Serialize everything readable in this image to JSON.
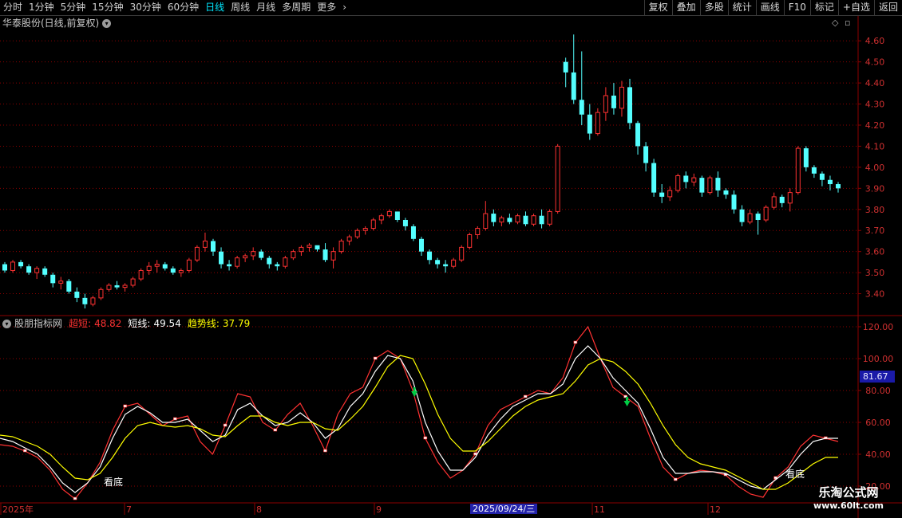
{
  "toolbar": {
    "periods": [
      "分时",
      "1分钟",
      "5分钟",
      "15分钟",
      "30分钟",
      "60分钟",
      "日线",
      "周线",
      "月线",
      "多周期",
      "更多"
    ],
    "active_period": "日线",
    "right_buttons": [
      "复权",
      "叠加",
      "多股",
      "统计",
      "画线",
      "F10",
      "标记",
      "+自选",
      "返回"
    ]
  },
  "main_chart": {
    "title": "华泰股份(日线,前复权)",
    "y_ticks": [
      "4.60",
      "4.50",
      "4.40",
      "4.30",
      "4.20",
      "4.10",
      "4.00",
      "3.90",
      "3.80",
      "3.70",
      "3.60",
      "3.50",
      "3.40"
    ]
  },
  "indicator": {
    "name": "股朋指标网",
    "label1": "超短:",
    "value1": "48.82",
    "label2": "短线:",
    "value2": "49.54",
    "label3": "趋势线:",
    "value3": "37.79",
    "y_ticks": [
      "120.00",
      "100.00",
      "80.00",
      "60.00",
      "40.00",
      "20.00"
    ],
    "current_value": "81.67",
    "signal_text": "看底"
  },
  "x_axis": {
    "labels": [
      "2025年",
      "7",
      "8",
      "9",
      "11",
      "12"
    ],
    "cursor_date": "2025/09/24/三"
  },
  "watermark": {
    "line1": "乐淘公式网",
    "line2": "www.60lt.com"
  },
  "colors": {
    "up": "#ff3232",
    "down": "#54ffff",
    "grid": "#8c0000",
    "short": "#ff3232",
    "mid": "#ffffff",
    "trend": "#ffff00"
  },
  "chart_data": {
    "type": "candlestick",
    "title": "华泰股份(日线,前复权)",
    "price_range": [
      3.3,
      4.65
    ],
    "indicator_range": [
      10,
      125
    ],
    "candles": [
      [
        3.54,
        3.55,
        3.5,
        3.51
      ],
      [
        3.51,
        3.56,
        3.5,
        3.55
      ],
      [
        3.55,
        3.56,
        3.52,
        3.53
      ],
      [
        3.53,
        3.54,
        3.49,
        3.5
      ],
      [
        3.5,
        3.53,
        3.47,
        3.52
      ],
      [
        3.52,
        3.53,
        3.48,
        3.49
      ],
      [
        3.49,
        3.5,
        3.43,
        3.45
      ],
      [
        3.45,
        3.48,
        3.42,
        3.46
      ],
      [
        3.46,
        3.47,
        3.4,
        3.41
      ],
      [
        3.41,
        3.43,
        3.36,
        3.38
      ],
      [
        3.38,
        3.4,
        3.33,
        3.35
      ],
      [
        3.35,
        3.39,
        3.34,
        3.38
      ],
      [
        3.38,
        3.43,
        3.37,
        3.42
      ],
      [
        3.42,
        3.45,
        3.41,
        3.44
      ],
      [
        3.44,
        3.46,
        3.42,
        3.43
      ],
      [
        3.43,
        3.45,
        3.41,
        3.44
      ],
      [
        3.44,
        3.48,
        3.43,
        3.47
      ],
      [
        3.47,
        3.52,
        3.46,
        3.51
      ],
      [
        3.51,
        3.55,
        3.49,
        3.53
      ],
      [
        3.53,
        3.56,
        3.5,
        3.54
      ],
      [
        3.54,
        3.55,
        3.51,
        3.52
      ],
      [
        3.52,
        3.53,
        3.49,
        3.5
      ],
      [
        3.5,
        3.52,
        3.48,
        3.51
      ],
      [
        3.51,
        3.57,
        3.5,
        3.56
      ],
      [
        3.56,
        3.63,
        3.55,
        3.62
      ],
      [
        3.62,
        3.69,
        3.6,
        3.65
      ],
      [
        3.65,
        3.66,
        3.58,
        3.6
      ],
      [
        3.6,
        3.62,
        3.52,
        3.54
      ],
      [
        3.54,
        3.56,
        3.51,
        3.53
      ],
      [
        3.53,
        3.58,
        3.52,
        3.57
      ],
      [
        3.57,
        3.59,
        3.55,
        3.58
      ],
      [
        3.58,
        3.62,
        3.56,
        3.6
      ],
      [
        3.6,
        3.61,
        3.56,
        3.57
      ],
      [
        3.57,
        3.58,
        3.52,
        3.54
      ],
      [
        3.54,
        3.55,
        3.51,
        3.53
      ],
      [
        3.53,
        3.58,
        3.52,
        3.57
      ],
      [
        3.57,
        3.61,
        3.56,
        3.6
      ],
      [
        3.6,
        3.63,
        3.58,
        3.62
      ],
      [
        3.62,
        3.64,
        3.6,
        3.63
      ],
      [
        3.63,
        3.62,
        3.6,
        3.61
      ],
      [
        3.61,
        3.64,
        3.55,
        3.56
      ],
      [
        3.56,
        3.62,
        3.52,
        3.6
      ],
      [
        3.6,
        3.66,
        3.59,
        3.65
      ],
      [
        3.65,
        3.68,
        3.63,
        3.67
      ],
      [
        3.67,
        3.71,
        3.66,
        3.7
      ],
      [
        3.7,
        3.72,
        3.68,
        3.71
      ],
      [
        3.71,
        3.76,
        3.7,
        3.75
      ],
      [
        3.75,
        3.78,
        3.73,
        3.77
      ],
      [
        3.77,
        3.8,
        3.76,
        3.79
      ],
      [
        3.79,
        3.78,
        3.74,
        3.75
      ],
      [
        3.75,
        3.76,
        3.7,
        3.72
      ],
      [
        3.72,
        3.73,
        3.65,
        3.66
      ],
      [
        3.66,
        3.67,
        3.58,
        3.6
      ],
      [
        3.6,
        3.61,
        3.54,
        3.56
      ],
      [
        3.56,
        3.57,
        3.52,
        3.54
      ],
      [
        3.54,
        3.56,
        3.5,
        3.53
      ],
      [
        3.53,
        3.57,
        3.52,
        3.56
      ],
      [
        3.56,
        3.63,
        3.55,
        3.62
      ],
      [
        3.62,
        3.69,
        3.61,
        3.68
      ],
      [
        3.68,
        3.72,
        3.66,
        3.71
      ],
      [
        3.71,
        3.84,
        3.7,
        3.78
      ],
      [
        3.78,
        3.8,
        3.72,
        3.74
      ],
      [
        3.74,
        3.77,
        3.72,
        3.76
      ],
      [
        3.76,
        3.78,
        3.73,
        3.74
      ],
      [
        3.74,
        3.78,
        3.73,
        3.77
      ],
      [
        3.77,
        3.79,
        3.72,
        3.73
      ],
      [
        3.73,
        3.78,
        3.72,
        3.77
      ],
      [
        3.77,
        3.8,
        3.71,
        3.73
      ],
      [
        3.73,
        3.8,
        3.72,
        3.79
      ],
      [
        3.79,
        4.11,
        3.78,
        4.1
      ],
      [
        4.5,
        4.52,
        4.38,
        4.45
      ],
      [
        4.45,
        4.63,
        4.3,
        4.32
      ],
      [
        4.32,
        4.55,
        4.2,
        4.25
      ],
      [
        4.25,
        4.3,
        4.13,
        4.16
      ],
      [
        4.16,
        4.28,
        4.15,
        4.26
      ],
      [
        4.26,
        4.38,
        4.22,
        4.34
      ],
      [
        4.34,
        4.4,
        4.25,
        4.28
      ],
      [
        4.28,
        4.41,
        4.24,
        4.38
      ],
      [
        4.38,
        4.42,
        4.18,
        4.21
      ],
      [
        4.21,
        4.22,
        4.06,
        4.1
      ],
      [
        4.1,
        4.12,
        3.98,
        4.02
      ],
      [
        4.02,
        4.04,
        3.86,
        3.88
      ],
      [
        3.88,
        3.92,
        3.83,
        3.86
      ],
      [
        3.86,
        3.91,
        3.84,
        3.89
      ],
      [
        3.89,
        3.97,
        3.88,
        3.96
      ],
      [
        3.96,
        3.98,
        3.9,
        3.93
      ],
      [
        3.93,
        3.97,
        3.91,
        3.95
      ],
      [
        3.95,
        3.96,
        3.86,
        3.88
      ],
      [
        3.88,
        3.96,
        3.87,
        3.95
      ],
      [
        3.95,
        3.98,
        3.86,
        3.89
      ],
      [
        3.89,
        3.9,
        3.85,
        3.87
      ],
      [
        3.87,
        3.89,
        3.78,
        3.8
      ],
      [
        3.8,
        3.82,
        3.72,
        3.74
      ],
      [
        3.74,
        3.8,
        3.73,
        3.78
      ],
      [
        3.78,
        3.79,
        3.68,
        3.75
      ],
      [
        3.75,
        3.82,
        3.74,
        3.81
      ],
      [
        3.81,
        3.88,
        3.8,
        3.86
      ],
      [
        3.86,
        3.87,
        3.81,
        3.83
      ],
      [
        3.83,
        3.9,
        3.79,
        3.88
      ],
      [
        3.88,
        4.1,
        3.87,
        4.09
      ],
      [
        4.09,
        4.1,
        3.98,
        4.0
      ],
      [
        4.0,
        4.01,
        3.95,
        3.97
      ],
      [
        3.97,
        3.98,
        3.91,
        3.94
      ],
      [
        3.94,
        3.96,
        3.89,
        3.92
      ],
      [
        3.92,
        3.93,
        3.88,
        3.9
      ]
    ],
    "series": [
      {
        "name": "超短",
        "values": [
          46,
          45,
          42,
          38,
          30,
          18,
          12,
          22,
          35,
          55,
          70,
          72,
          65,
          58,
          62,
          64,
          48,
          40,
          58,
          78,
          76,
          60,
          55,
          65,
          72,
          58,
          42,
          65,
          78,
          82,
          100,
          105,
          100,
          80,
          50,
          35,
          25,
          30,
          40,
          58,
          68,
          72,
          76,
          80,
          78,
          88,
          110,
          120,
          100,
          82,
          76,
          70,
          50,
          32,
          24,
          28,
          30,
          29,
          27,
          20,
          15,
          13,
          25,
          32,
          45,
          52,
          50,
          48
        ]
      },
      {
        "name": "短线",
        "values": [
          50,
          48,
          44,
          40,
          32,
          22,
          16,
          22,
          32,
          50,
          65,
          70,
          66,
          60,
          60,
          62,
          55,
          48,
          52,
          68,
          72,
          64,
          58,
          60,
          66,
          60,
          50,
          56,
          70,
          78,
          92,
          102,
          100,
          86,
          60,
          42,
          30,
          30,
          38,
          52,
          62,
          70,
          74,
          78,
          78,
          84,
          100,
          108,
          100,
          88,
          80,
          72,
          56,
          38,
          28,
          28,
          29,
          29,
          28,
          24,
          20,
          18,
          24,
          30,
          40,
          48,
          50,
          50
        ]
      },
      {
        "name": "趋势线",
        "values": [
          52,
          51,
          48,
          45,
          40,
          32,
          25,
          24,
          28,
          38,
          50,
          58,
          60,
          58,
          57,
          58,
          56,
          52,
          51,
          58,
          64,
          64,
          60,
          58,
          60,
          60,
          56,
          55,
          62,
          70,
          82,
          95,
          102,
          100,
          84,
          65,
          50,
          42,
          42,
          48,
          56,
          64,
          70,
          74,
          76,
          78,
          86,
          96,
          100,
          98,
          92,
          84,
          72,
          58,
          46,
          38,
          34,
          32,
          30,
          26,
          22,
          18,
          18,
          22,
          28,
          34,
          38,
          38
        ]
      }
    ],
    "signals": [
      {
        "type": "down-arrow",
        "index": 33
      },
      {
        "type": "down-arrow",
        "index": 50
      }
    ]
  }
}
